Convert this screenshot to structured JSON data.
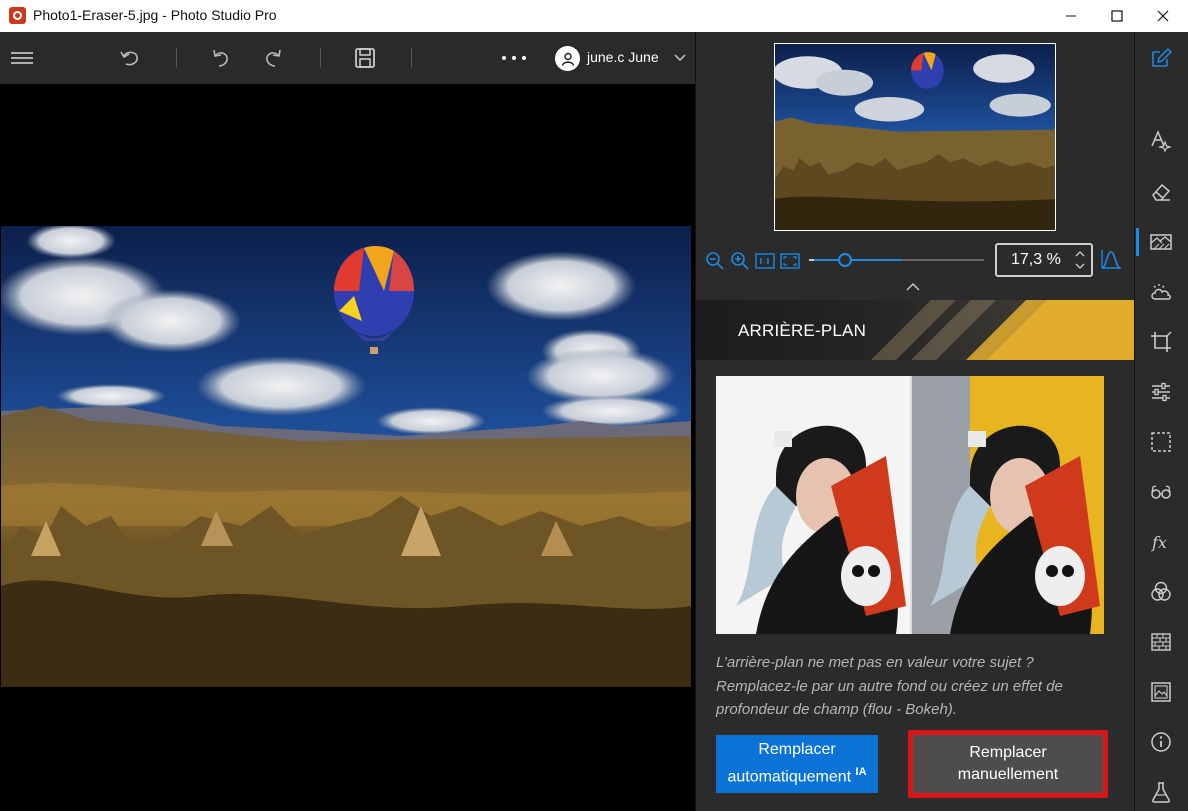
{
  "window": {
    "title": "Photo1-Eraser-5.jpg - Photo Studio Pro"
  },
  "toolbar": {
    "user_name": "june.c June",
    "more_label": "···"
  },
  "navigator": {
    "zoom_value": "17,3 %",
    "zoom_fraction": 0.18
  },
  "section": {
    "title": "ARRIÈRE-PLAN"
  },
  "background_panel": {
    "description": "L’arrière-plan ne met pas en valeur votre sujet ? Remplacez-le par un autre fond ou créez un effet de profondeur de champ (flou - Bokeh).",
    "auto_button_line1": "Remplacer",
    "auto_button_line2": "automatiquement",
    "auto_button_badge": "IA",
    "manual_button_line1": "Remplacer",
    "manual_button_line2": "manuellement"
  },
  "colors": {
    "accent": "#1a8ae5",
    "primary_button": "#0b73d6",
    "highlight_border": "#d61414"
  }
}
